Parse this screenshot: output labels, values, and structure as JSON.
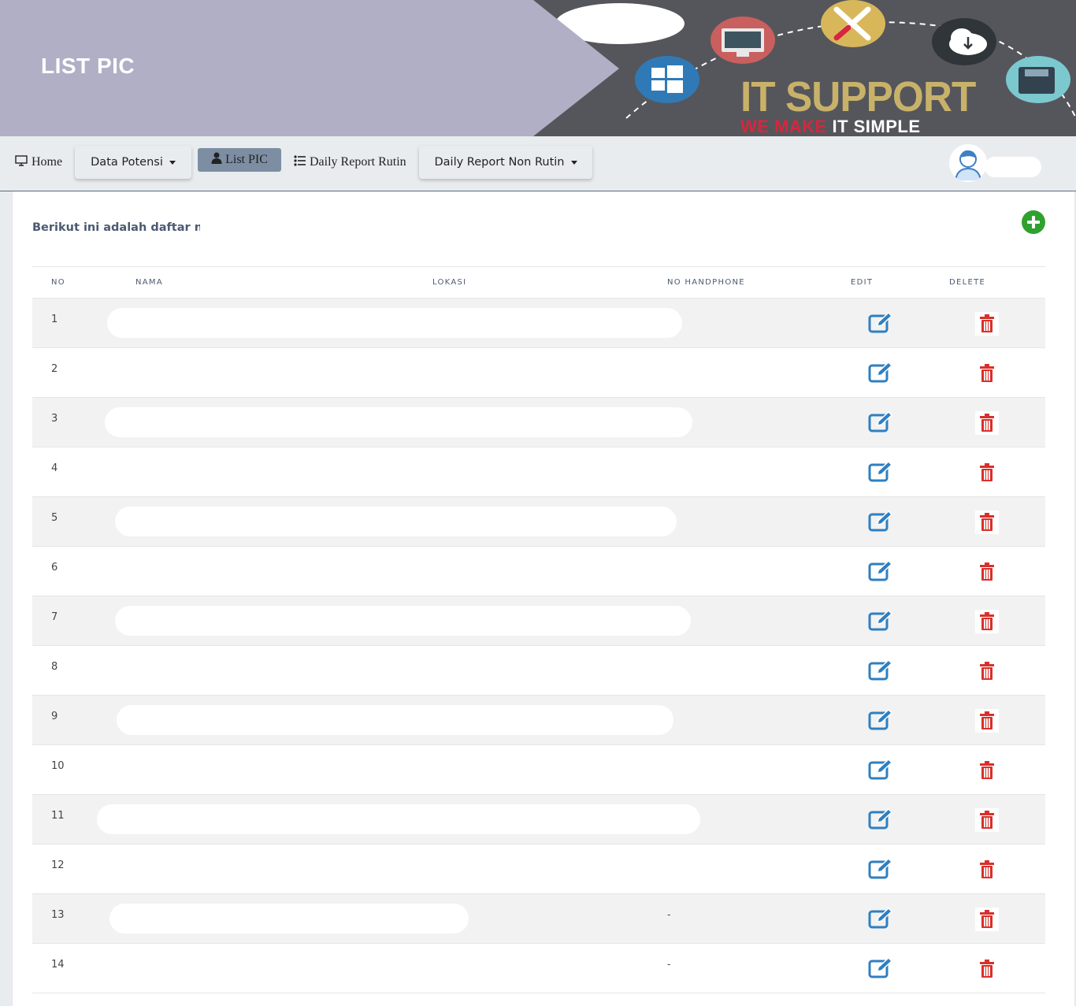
{
  "header": {
    "title": "LIST PIC",
    "brand": "IT SUPPORT",
    "tagline_red": "WE MAKE",
    "tagline_white": "IT SIMPLE"
  },
  "nav": {
    "home": "Home",
    "data_potensi": "Data Potensi",
    "list_pic": "List PIC",
    "daily_report_rutin": "Daily Report Rutin",
    "daily_report_non_rutin": "Daily Report Non Rutin"
  },
  "content": {
    "intro": "Berikut ini adalah daftar nama"
  },
  "table": {
    "columns": {
      "no": "NO",
      "nama": "NAMA",
      "lokasi": "LOKASI",
      "no_handphone": "NO HANDPHONE",
      "edit": "EDIT",
      "delete": "DELETE"
    },
    "rows": [
      {
        "no": "1",
        "nama": "",
        "lokasi": "",
        "no_handphone": ""
      },
      {
        "no": "2",
        "nama": "",
        "lokasi": "",
        "no_handphone": ""
      },
      {
        "no": "3",
        "nama": "",
        "lokasi": "",
        "no_handphone": ""
      },
      {
        "no": "4",
        "nama": "",
        "lokasi": "",
        "no_handphone": ""
      },
      {
        "no": "5",
        "nama": "",
        "lokasi": "",
        "no_handphone": ""
      },
      {
        "no": "6",
        "nama": "",
        "lokasi": "",
        "no_handphone": ""
      },
      {
        "no": "7",
        "nama": "",
        "lokasi": "",
        "no_handphone": ""
      },
      {
        "no": "8",
        "nama": "",
        "lokasi": "",
        "no_handphone": ""
      },
      {
        "no": "9",
        "nama": "",
        "lokasi": "",
        "no_handphone": ""
      },
      {
        "no": "10",
        "nama": "",
        "lokasi": "",
        "no_handphone": ""
      },
      {
        "no": "11",
        "nama": "",
        "lokasi": "",
        "no_handphone": ""
      },
      {
        "no": "12",
        "nama": "",
        "lokasi": "",
        "no_handphone": ""
      },
      {
        "no": "13",
        "nama": "",
        "lokasi": "",
        "no_handphone": "-"
      },
      {
        "no": "14",
        "nama": "",
        "lokasi": "",
        "no_handphone": "-"
      }
    ]
  },
  "colors": {
    "banner_left": "#b0afc6",
    "banner_right": "#55565b",
    "active_nav": "#7d8ea3",
    "add_button": "#2fa12f",
    "edit_icon": "#2f7fc0",
    "delete_icon": "#d8302a"
  },
  "icons": {
    "home": "monitor-icon",
    "list_pic": "user-icon",
    "daily_report_rutin": "list-icon",
    "add": "plus-circle-icon",
    "edit": "edit-icon",
    "delete": "trash-icon"
  }
}
